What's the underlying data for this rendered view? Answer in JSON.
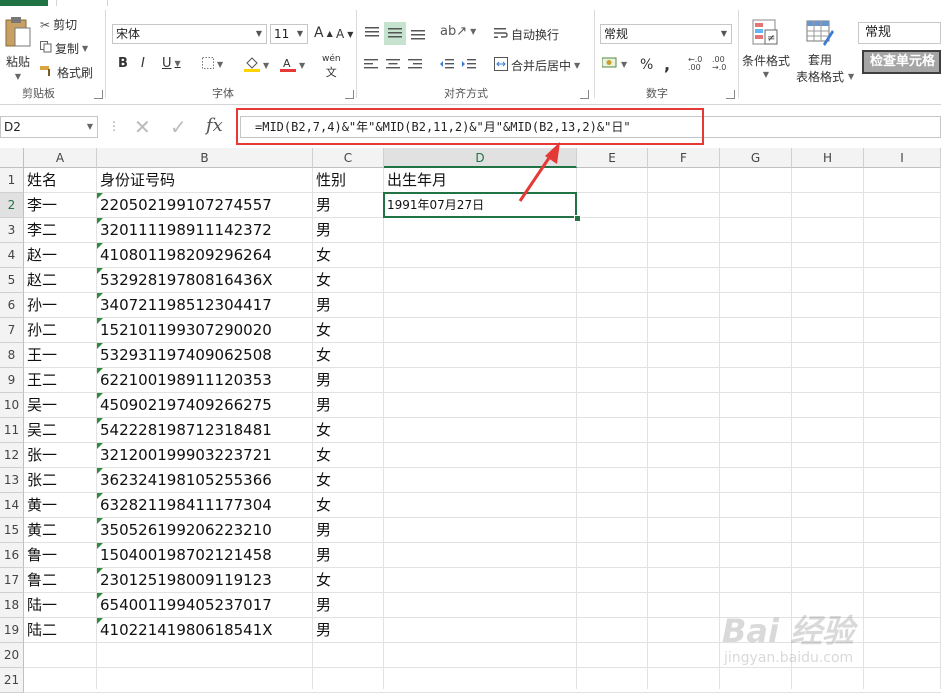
{
  "ribbon": {
    "clipboard": {
      "paste": "粘贴",
      "cut": "剪切",
      "copy": "复制",
      "format_painter": "格式刷",
      "group": "剪贴板"
    },
    "font": {
      "name": "宋体",
      "size": "11",
      "grow": "A",
      "shrink": "A",
      "bold": "B",
      "italic": "I",
      "underline": "U",
      "phonetic": "wén",
      "group": "字体"
    },
    "alignment": {
      "wrap": "自动换行",
      "merge": "合并后居中",
      "group": "对齐方式"
    },
    "number": {
      "format": "常规",
      "percent": "%",
      "comma": ",",
      "group": "数字"
    },
    "styles": {
      "conditional": "条件格式",
      "table_line1": "套用",
      "table_line2": "表格格式",
      "style_normal": "常规",
      "style_check": "检查单元格"
    }
  },
  "formula_bar": {
    "name_box": "D2",
    "fx": "fx",
    "formula": "=MID(B2,7,4)&\"年\"&MID(B2,11,2)&\"月\"&MID(B2,13,2)&\"日\""
  },
  "columns": [
    "A",
    "B",
    "C",
    "D",
    "E",
    "F",
    "G",
    "H",
    "I"
  ],
  "rows": [
    "1",
    "2",
    "3",
    "4",
    "5",
    "6",
    "7",
    "8",
    "9",
    "10",
    "11",
    "12",
    "13",
    "14",
    "15",
    "16",
    "17",
    "18",
    "19",
    "20",
    "21"
  ],
  "headers": {
    "name": "姓名",
    "id": "身份证号码",
    "gender": "性别",
    "birth": "出生年月"
  },
  "records": [
    {
      "name": "李一",
      "id": "220502199107274557",
      "gender": "男"
    },
    {
      "name": "李二",
      "id": "320111198911142372",
      "gender": "男"
    },
    {
      "name": "赵一",
      "id": "410801198209296264",
      "gender": "女"
    },
    {
      "name": "赵二",
      "id": "53292819780816436X",
      "gender": "女"
    },
    {
      "name": "孙一",
      "id": "340721198512304417",
      "gender": "男"
    },
    {
      "name": "孙二",
      "id": "152101199307290020",
      "gender": "女"
    },
    {
      "name": "王一",
      "id": "532931197409062508",
      "gender": "女"
    },
    {
      "name": "王二",
      "id": "622100198911120353",
      "gender": "男"
    },
    {
      "name": "吴一",
      "id": "450902197409266275",
      "gender": "男"
    },
    {
      "name": "吴二",
      "id": "542228198712318481",
      "gender": "女"
    },
    {
      "name": "张一",
      "id": "321200199903223721",
      "gender": "女"
    },
    {
      "name": "张二",
      "id": "362324198105255366",
      "gender": "女"
    },
    {
      "name": "黄一",
      "id": "632821198411177304",
      "gender": "女"
    },
    {
      "name": "黄二",
      "id": "350526199206223210",
      "gender": "男"
    },
    {
      "name": "鲁一",
      "id": "150400198702121458",
      "gender": "男"
    },
    {
      "name": "鲁二",
      "id": "230125198009119123",
      "gender": "女"
    },
    {
      "name": "陆一",
      "id": "654001199405237017",
      "gender": "男"
    },
    {
      "name": "陆二",
      "id": "41022141980618541X",
      "gender": "男"
    }
  ],
  "d2_value": "1991年07月27日",
  "watermark": {
    "main": "Bai 经验",
    "sub": "jingyan.baidu.com"
  },
  "colors": {
    "excel_green": "#217346",
    "annotation_red": "#e53935",
    "error_triangle": "#2e8b3e"
  }
}
